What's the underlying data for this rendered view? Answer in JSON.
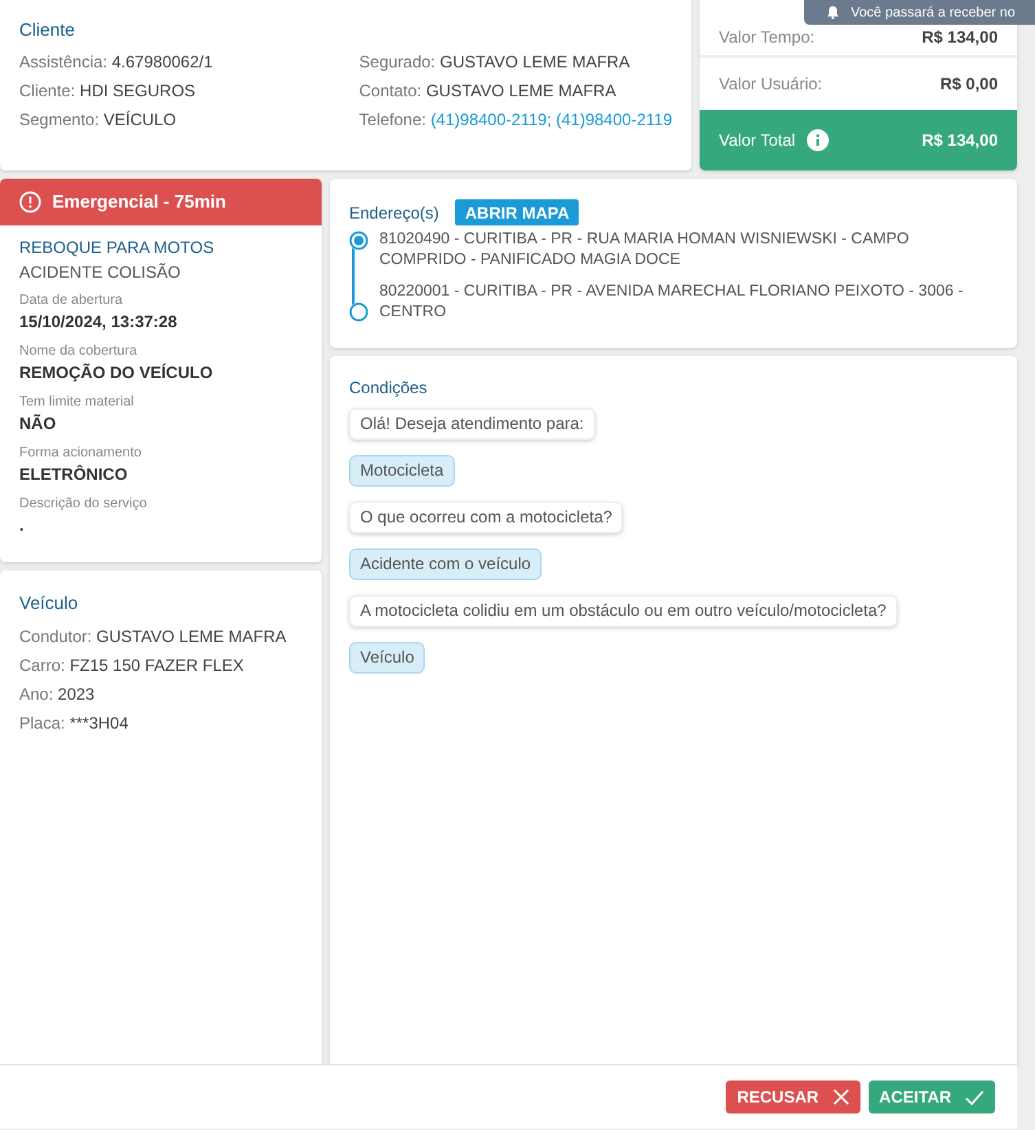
{
  "cliente": {
    "title": "Cliente",
    "left": [
      {
        "label": "Assistência:",
        "value": "4.67980062/1"
      },
      {
        "label": "Cliente:",
        "value": "HDI SEGUROS"
      },
      {
        "label": "Segmento:",
        "value": "VEÍCULO"
      }
    ],
    "right": [
      {
        "label": "Segurado:",
        "value": "GUSTAVO LEME MAFRA",
        "kind": "text"
      },
      {
        "label": "Contato:",
        "value": "GUSTAVO LEME MAFRA",
        "kind": "text"
      },
      {
        "label": "Telefone:",
        "value": "(41)98400-2119; (41)98400-2119",
        "kind": "link"
      }
    ]
  },
  "valores": {
    "rows": [
      {
        "label": "Valor Tempo:",
        "value": "R$ 134,00"
      },
      {
        "label": "Valor Usuário:",
        "value": "R$ 0,00"
      }
    ],
    "total": {
      "label": "Valor Total",
      "value": "R$ 134,00"
    }
  },
  "toast": "Você passará a receber no",
  "servico": {
    "badge": "Emergencial - 75min",
    "title": "REBOQUE PARA MOTOS",
    "subtitle": "ACIDENTE COLISÃO",
    "fields": [
      {
        "label": "Data de abertura",
        "value": "15/10/2024, 13:37:28"
      },
      {
        "label": "Nome da cobertura",
        "value": "REMOÇÃO DO VEÍCULO"
      },
      {
        "label": "Tem limite material",
        "value": "NÃO"
      },
      {
        "label": "Forma acionamento",
        "value": "ELETRÔNICO"
      },
      {
        "label": "Descrição do serviço",
        "value": "."
      }
    ]
  },
  "veiculo": {
    "title": "Veículo",
    "rows": [
      {
        "label": "Condutor:",
        "value": "GUSTAVO LEME MAFRA"
      },
      {
        "label": "Carro:",
        "value": "FZ15 150 FAZER FLEX"
      },
      {
        "label": "Ano:",
        "value": "2023"
      },
      {
        "label": "Placa:",
        "value": "***3H04"
      }
    ]
  },
  "enderecos": {
    "title": "Endereço(s)",
    "button": "ABRIR MAPA",
    "items": [
      {
        "kind": "origin",
        "text": "81020490 - CURITIBA - PR - RUA MARIA HOMAN WISNIEWSKI - CAMPO COMPRIDO - PANIFICADO MAGIA DOCE"
      },
      {
        "kind": "destination",
        "text": "80220001 - CURITIBA - PR - AVENIDA MARECHAL FLORIANO PEIXOTO - 3006 - CENTRO"
      }
    ]
  },
  "condicoes": {
    "title": "Condições",
    "messages": [
      {
        "kind": "question",
        "text": "Olá! Deseja atendimento para:"
      },
      {
        "kind": "answer",
        "text": "Motocicleta"
      },
      {
        "kind": "question",
        "text": "O que ocorreu com a motocicleta?"
      },
      {
        "kind": "answer",
        "text": "Acidente com o veículo"
      },
      {
        "kind": "question",
        "text": "A motocicleta colidiu em um obstáculo ou em outro veículo/motocicleta?"
      },
      {
        "kind": "answer",
        "text": "Veículo"
      }
    ]
  },
  "actions": [
    {
      "kind": "reject",
      "label": "RECUSAR"
    },
    {
      "kind": "accept",
      "label": "ACEITAR"
    }
  ]
}
